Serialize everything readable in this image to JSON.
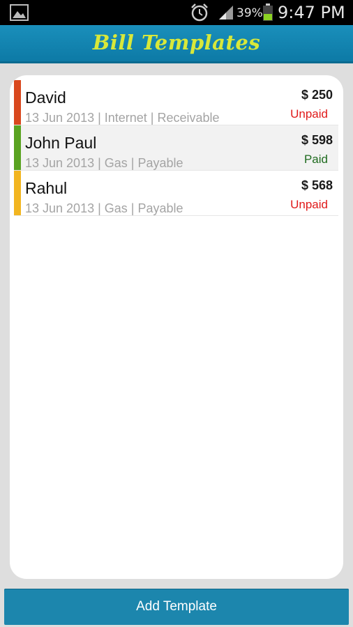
{
  "status_bar": {
    "battery_percent": "39%",
    "time": "9:47 PM",
    "icons": [
      "image-icon",
      "alarm-icon",
      "signal-icon",
      "battery-icon"
    ]
  },
  "header": {
    "title": "Bill Templates"
  },
  "bills": [
    {
      "name": "David",
      "meta": "13 Jun 2013 | Internet | Receivable",
      "amount": "$ 250",
      "status": "Unpaid",
      "status_color": "#e01a1a",
      "bar_color": "#d9481e"
    },
    {
      "name": "John Paul",
      "meta": "13 Jun 2013 | Gas | Payable",
      "amount": "$ 598",
      "status": "Paid",
      "status_color": "#1f6b1f",
      "bar_color": "#5aa321"
    },
    {
      "name": "Rahul",
      "meta": "13 Jun 2013 | Gas | Payable",
      "amount": "$ 568",
      "status": "Unpaid",
      "status_color": "#e01a1a",
      "bar_color": "#f2b520"
    }
  ],
  "footer": {
    "add_label": "Add Template"
  },
  "colors": {
    "header_bg": "#148ab7",
    "title": "#d8e83a",
    "button_bg": "#1c86ad"
  }
}
